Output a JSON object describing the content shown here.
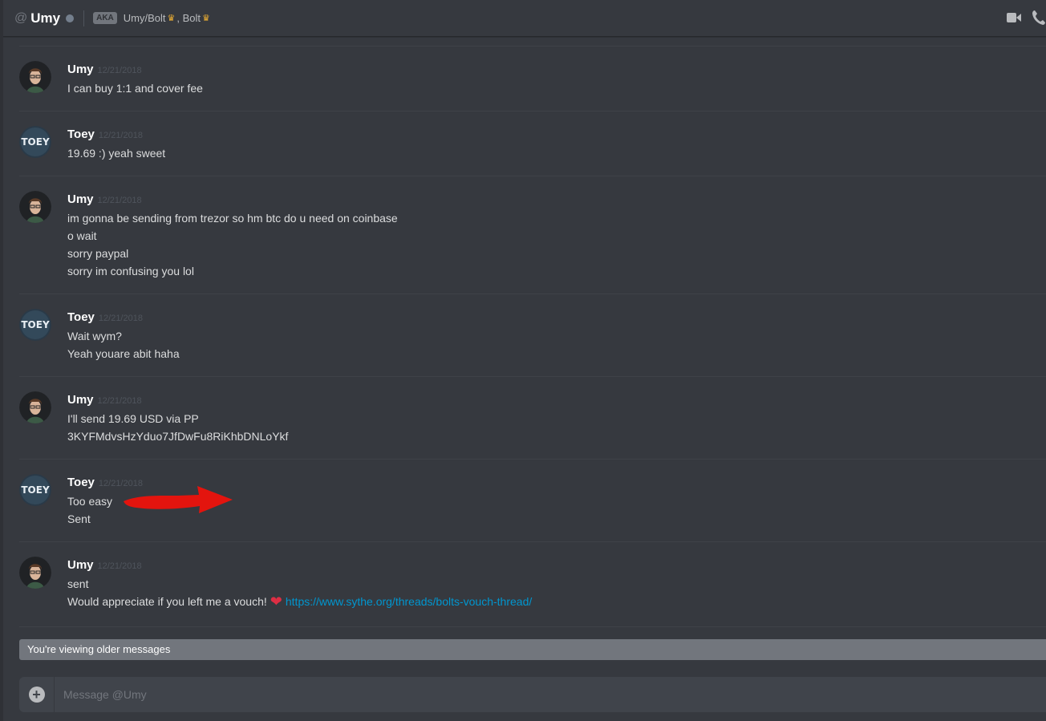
{
  "header": {
    "at_symbol": "@",
    "recipient": "Umy",
    "aka_badge": "AKA",
    "aka_name_1": "Umy/Bolt",
    "aka_separator": ",",
    "aka_name_2": "Bolt",
    "crown_glyph": "♛",
    "icons": [
      "video-call-icon",
      "voice-call-icon"
    ]
  },
  "messages": [
    {
      "author": "Umy",
      "timestamp": "12/21/2018",
      "lines": [
        "I can buy 1:1 and cover fee"
      ]
    },
    {
      "author": "Toey",
      "timestamp": "12/21/2018",
      "lines": [
        "19.69 :) yeah sweet"
      ]
    },
    {
      "author": "Umy",
      "timestamp": "12/21/2018",
      "lines": [
        "im gonna be sending from trezor so hm btc do u need on coinbase",
        "o wait",
        "sorry paypal",
        "sorry im confusing you lol"
      ]
    },
    {
      "author": "Toey",
      "timestamp": "12/21/2018",
      "lines": [
        "Wait wym?",
        "Yeah youare abit haha"
      ]
    },
    {
      "author": "Umy",
      "timestamp": "12/21/2018",
      "lines": [
        "I'll send 19.69 USD via PP",
        "3KYFMdvsHzYduo7JfDwFu8RiKhbDNLoYkf"
      ]
    },
    {
      "author": "Toey",
      "timestamp": "12/21/2018",
      "lines": [
        "Too easy",
        "Sent"
      ]
    },
    {
      "author": "Umy",
      "timestamp": "12/21/2018",
      "lines": [
        "sent"
      ],
      "last_line_text": "Would appreciate if you left me a vouch!",
      "heart_glyph": "❤",
      "link": "https://www.sythe.org/threads/bolts-vouch-thread/"
    }
  ],
  "avatars": {
    "Umy": "umy-avatar",
    "Toey": "toey-avatar",
    "toey_avatar_text": "TOEY"
  },
  "older_messages_notice": "You're viewing older messages",
  "composer": {
    "add_glyph": "+",
    "placeholder": "Message @Umy"
  },
  "colors": {
    "background": "#36393f",
    "link": "#0096cf",
    "username": "#ffffff",
    "timestamp": "#4f545c",
    "annotation_red": "#e3140e",
    "heart": "#dd2e44"
  }
}
